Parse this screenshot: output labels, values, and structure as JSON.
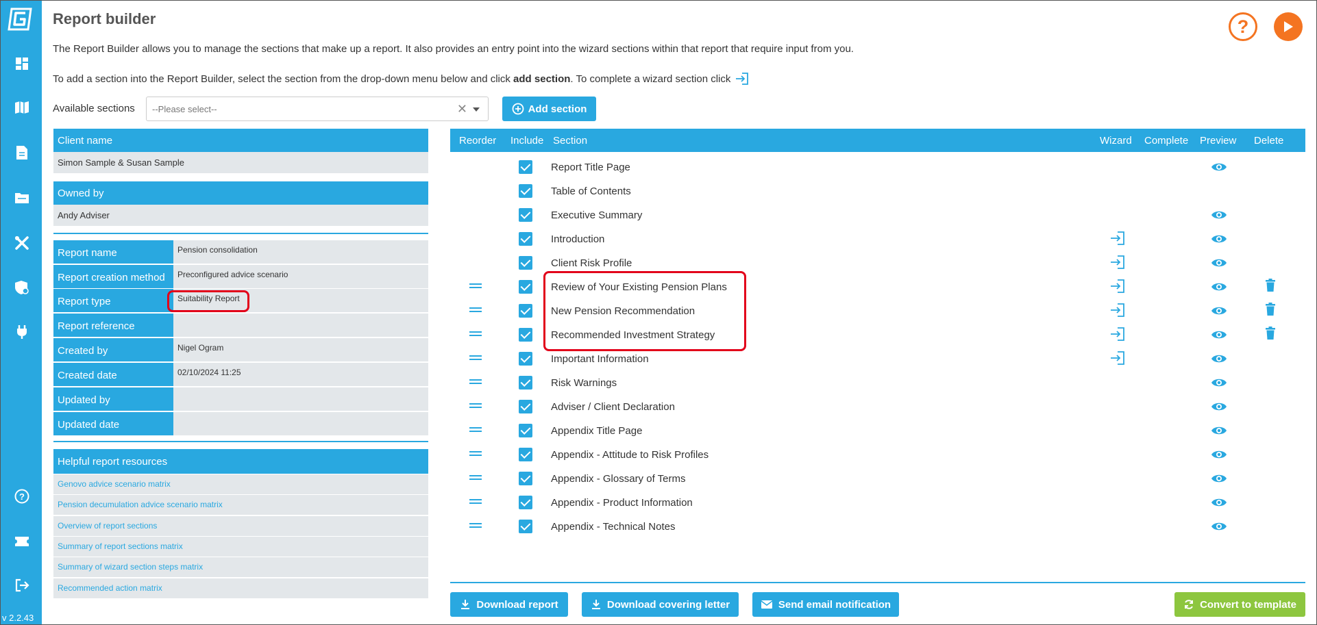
{
  "app": {
    "version": "v 2.2.43"
  },
  "header": {
    "title": "Report builder",
    "intro_1": "The Report Builder allows you to manage the sections that make up a report. It also provides an entry point into the wizard sections within that report that require input from you.",
    "intro_2_prefix": "To add a section into the Report Builder, select the section from the drop-down menu below and click ",
    "intro_2_bold": "add section",
    "intro_2_suffix": ". To complete a wizard section click"
  },
  "controls": {
    "available_label": "Available sections",
    "select_placeholder": "--Please select--",
    "add_section_label": "Add section"
  },
  "client": {
    "client_name_label": "Client name",
    "client_name": "Simon Sample & Susan Sample",
    "owned_by_label": "Owned by",
    "owned_by": "Andy Adviser"
  },
  "report_info": [
    {
      "label": "Report name",
      "value": "Pension consolidation"
    },
    {
      "label": "Report creation method",
      "value": "Preconfigured advice scenario"
    },
    {
      "label": "Report type",
      "value": "Suitability Report"
    },
    {
      "label": "Report reference",
      "value": ""
    },
    {
      "label": "Created by",
      "value": "Nigel Ogram"
    },
    {
      "label": "Created date",
      "value": "02/10/2024 11:25"
    },
    {
      "label": "Updated by",
      "value": ""
    },
    {
      "label": "Updated date",
      "value": ""
    }
  ],
  "resources": {
    "title": "Helpful report resources",
    "links": [
      "Genovo advice scenario matrix",
      "Pension decumulation advice scenario matrix",
      "Overview of report sections",
      "Summary of report sections matrix",
      "Summary of wizard section steps matrix",
      "Recommended action matrix"
    ]
  },
  "table": {
    "columns": [
      "Reorder",
      "Include",
      "Section",
      "Wizard",
      "Complete",
      "Preview",
      "Delete"
    ],
    "rows": [
      {
        "name": "Report Title Page",
        "reorder": false,
        "include": true,
        "wizard": false,
        "preview": true,
        "delete": false
      },
      {
        "name": "Table of Contents",
        "reorder": false,
        "include": true,
        "wizard": false,
        "preview": false,
        "delete": false
      },
      {
        "name": "Executive Summary",
        "reorder": false,
        "include": true,
        "wizard": false,
        "preview": true,
        "delete": false
      },
      {
        "name": "Introduction",
        "reorder": false,
        "include": true,
        "wizard": true,
        "preview": true,
        "delete": false
      },
      {
        "name": "Client Risk Profile",
        "reorder": false,
        "include": true,
        "wizard": true,
        "preview": true,
        "delete": false
      },
      {
        "name": "Review of Your Existing Pension Plans",
        "reorder": true,
        "include": true,
        "wizard": true,
        "preview": true,
        "delete": true
      },
      {
        "name": "New Pension Recommendation",
        "reorder": true,
        "include": true,
        "wizard": true,
        "preview": true,
        "delete": true
      },
      {
        "name": "Recommended Investment Strategy",
        "reorder": true,
        "include": true,
        "wizard": true,
        "preview": true,
        "delete": true
      },
      {
        "name": "Important Information",
        "reorder": true,
        "include": true,
        "wizard": true,
        "preview": true,
        "delete": false
      },
      {
        "name": "Risk Warnings",
        "reorder": true,
        "include": true,
        "wizard": false,
        "preview": true,
        "delete": false
      },
      {
        "name": "Adviser / Client Declaration",
        "reorder": true,
        "include": true,
        "wizard": false,
        "preview": true,
        "delete": false
      },
      {
        "name": "Appendix Title Page",
        "reorder": true,
        "include": true,
        "wizard": false,
        "preview": true,
        "delete": false
      },
      {
        "name": "Appendix - Attitude to Risk Profiles",
        "reorder": true,
        "include": true,
        "wizard": false,
        "preview": true,
        "delete": false
      },
      {
        "name": "Appendix - Glossary of Terms",
        "reorder": true,
        "include": true,
        "wizard": false,
        "preview": true,
        "delete": false
      },
      {
        "name": "Appendix - Product Information",
        "reorder": true,
        "include": true,
        "wizard": false,
        "preview": true,
        "delete": false
      },
      {
        "name": "Appendix - Technical Notes",
        "reorder": true,
        "include": true,
        "wizard": false,
        "preview": true,
        "delete": false
      }
    ]
  },
  "footer": {
    "download_report": "Download report",
    "download_covering_letter": "Download covering letter",
    "send_email": "Send email notification",
    "convert_template": "Convert to template"
  },
  "colors": {
    "primary": "#29a8e0",
    "accent_orange": "#f47421",
    "highlight_red": "#e2001a",
    "success_green": "#8dc63f",
    "cell_grey": "#e3e7ea"
  }
}
